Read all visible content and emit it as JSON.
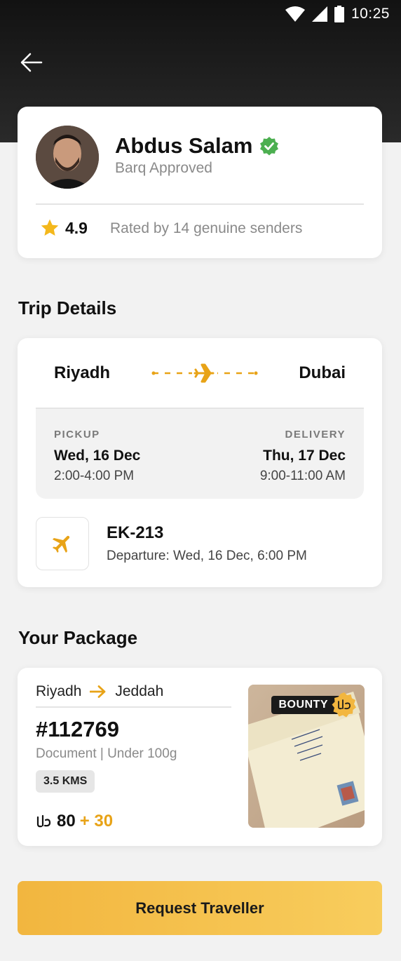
{
  "status_bar": {
    "time": "10:25",
    "icons": [
      "wifi-icon",
      "signal-icon",
      "battery-icon"
    ]
  },
  "nav": {
    "back_icon": "arrow-left-icon"
  },
  "traveller": {
    "name": "Abdus Salam",
    "verified_icon": "verified-badge-icon",
    "status": "Barq Approved",
    "rating": "4.9",
    "rating_text": "Rated by 14 genuine senders"
  },
  "trip": {
    "title": "Trip Details",
    "from": "Riyadh",
    "to": "Dubai",
    "pickup_label": "PICKUP",
    "pickup_date": "Wed, 16 Dec",
    "pickup_time": "2:00-4:00 PM",
    "delivery_label": "DELIVERY",
    "delivery_date": "Thu, 17 Dec",
    "delivery_time": "9:00-11:00 AM",
    "flight_no": "EK-213",
    "departure": "Departure: Wed, 16 Dec, 6:00 PM"
  },
  "package": {
    "title": "Your Package",
    "from": "Riyadh",
    "to": "Jeddah",
    "id": "#112769",
    "type": "Document | Under 100g",
    "distance": "3.5 KMS",
    "price": "80",
    "bonus": "+ 30",
    "bounty_label": "BOUNTY"
  },
  "cta": {
    "label": "Request Traveller"
  },
  "colors": {
    "accent": "#e8a317",
    "verified": "#4caf50",
    "dark": "#121212"
  }
}
